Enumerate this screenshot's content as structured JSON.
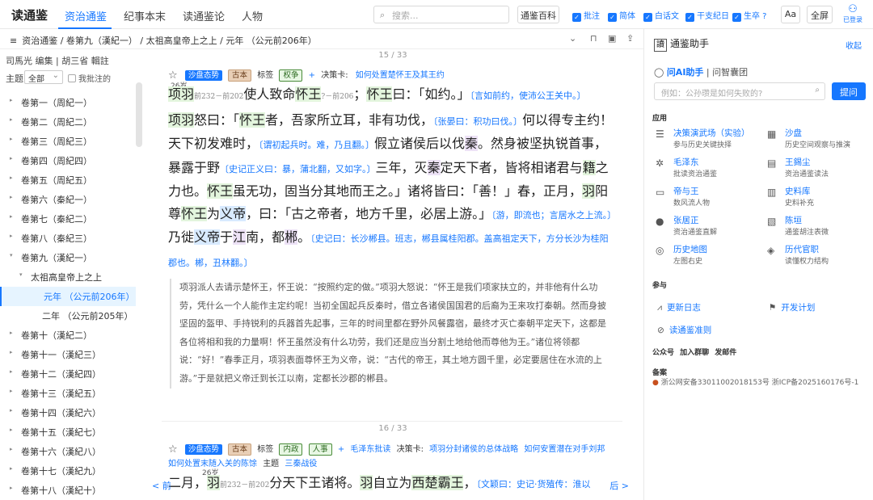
{
  "app": {
    "logo": "读通鉴"
  },
  "nav": {
    "tabs": [
      "资治通鉴",
      "纪事本末",
      "读通鉴论",
      "人物"
    ]
  },
  "search": {
    "placeholder": "搜索..."
  },
  "toolbar": {
    "encyclopedia": "通鉴百科",
    "toggles": [
      "批注",
      "简体",
      "白话文",
      "干支纪日",
      "生卒 ?"
    ],
    "font": "Aa",
    "fullscreen": "全屏",
    "login": "已登录"
  },
  "breadcrumb": {
    "text": "资治通鉴 / 卷第九（漢紀一） / 太祖高皇帝上之上 / 元年 （公元前206年）"
  },
  "sidebar": {
    "authors": "司馬光 编集 | 胡三省 輯註",
    "theme_label": "主题",
    "theme_value": "全部",
    "only_annotated": "我批注的",
    "volumes": [
      {
        "label": "卷第一（周紀一）",
        "level": 0,
        "arrow": "▸"
      },
      {
        "label": "卷第二（周紀二）",
        "level": 0,
        "arrow": "▸"
      },
      {
        "label": "卷第三（周紀三）",
        "level": 0,
        "arrow": "▸"
      },
      {
        "label": "卷第四（周紀四）",
        "level": 0,
        "arrow": "▸"
      },
      {
        "label": "卷第五（周紀五）",
        "level": 0,
        "arrow": "▸"
      },
      {
        "label": "卷第六（秦紀一）",
        "level": 0,
        "arrow": "▸"
      },
      {
        "label": "卷第七（秦紀二）",
        "level": 0,
        "arrow": "▸"
      },
      {
        "label": "卷第八（秦紀三）",
        "level": 0,
        "arrow": "▸"
      },
      {
        "label": "卷第九（漢紀一）",
        "level": 0,
        "arrow": "▾"
      },
      {
        "label": "太祖高皇帝上之上",
        "level": 1,
        "arrow": "▾"
      },
      {
        "label": "元年 （公元前206年）",
        "level": 2,
        "arrow": "",
        "selected": true
      },
      {
        "label": "二年 （公元前205年）",
        "level": 2,
        "arrow": ""
      },
      {
        "label": "卷第十（漢紀二）",
        "level": 0,
        "arrow": "▸"
      },
      {
        "label": "卷第十一（漢紀三）",
        "level": 0,
        "arrow": "▸"
      },
      {
        "label": "卷第十二（漢紀四）",
        "level": 0,
        "arrow": "▸"
      },
      {
        "label": "卷第十三（漢紀五）",
        "level": 0,
        "arrow": "▸"
      },
      {
        "label": "卷第十四（漢紀六）",
        "level": 0,
        "arrow": "▸"
      },
      {
        "label": "卷第十五（漢紀七）",
        "level": 0,
        "arrow": "▸"
      },
      {
        "label": "卷第十六（漢紀八）",
        "level": 0,
        "arrow": "▸"
      },
      {
        "label": "卷第十七（漢紀九）",
        "level": 0,
        "arrow": "▸"
      },
      {
        "label": "卷第十八（漢紀十）",
        "level": 0,
        "arrow": "▸"
      }
    ]
  },
  "content": {
    "page1": "15 / 33",
    "page2": "16 / 33",
    "p1": {
      "tags": [
        "沙盘态势",
        "古本"
      ],
      "tag_label": "标签",
      "label_tags": [
        "权争"
      ],
      "plus": "+",
      "card_label": "决策卡:",
      "cards": [
        "如何处置楚怀王及其王约"
      ],
      "age": "26岁"
    },
    "p2": {
      "tags": [
        "沙盘态势",
        "古本"
      ],
      "tag_label": "标签",
      "label_tags": [
        "内政",
        "人事"
      ],
      "plus": "+",
      "commentary": "毛泽东批读",
      "card_label": "决策卡:",
      "cards": [
        "项羽分封诸侯的总体战略",
        "如何安置潜在对手刘邦",
        "如何处置末随入关的陈馀"
      ],
      "theme_label": "主题",
      "theme": "三秦战役",
      "age": "26岁"
    },
    "translation": "项羽派人去请示楚怀王，怀王说：“按照约定的做。”项羽大怒说：“怀王是我们项家扶立的，并非他有什么功劳，凭什么一个人能作主定约呢！当初全国起兵反秦时，借立各诸侯国国君的后裔为王来攻打秦朝。然而身披坚固的盔甲、手持锐利的兵器首先起事，三年的时间里都在野外风餐露宿，最终才灭亡秦朝平定天下，这都是各位将相和我的力量啊！怀王虽然没有什么功劳，我们还是应当分割土地给他而尊他为王。”诸位将领都说：“好！”春季正月，项羽表面尊怀王为义帝，说：“古代的帝王，其土地方圆千里，必定要居住在水流的上游。”于是就把义帝迁到长江以南，定都长沙郡的郴县。",
    "prev": "< 前",
    "next": "后 >"
  },
  "right": {
    "title": "通鉴助手",
    "badge": "讀",
    "collapse": "收起",
    "ai_title": "问AI助手",
    "ai_sub": "| 问智囊团",
    "ai_placeholder": "例如：公孙瓒是如何失败的?",
    "ask": "提问",
    "apps_label": "应用",
    "apps": [
      {
        "name": "决策演武场（实验）",
        "desc": "参与历史关键抉择",
        "icon": "☰"
      },
      {
        "name": "沙盘",
        "desc": "历史空间观察与推演",
        "icon": "▦"
      },
      {
        "name": "毛泽东",
        "desc": "批读资治通鉴",
        "icon": "✲"
      },
      {
        "name": "王錫尘",
        "desc": "资治通鉴读法",
        "icon": "▤"
      },
      {
        "name": "帝与王",
        "desc": "数风流人物",
        "icon": "▭"
      },
      {
        "name": "史料库",
        "desc": "史料补充",
        "icon": "▥"
      },
      {
        "name": "张居正",
        "desc": "资治通鉴直解",
        "icon": "●"
      },
      {
        "name": "陈垣",
        "desc": "通鉴胡注表微",
        "icon": "▧"
      },
      {
        "name": "历史地图",
        "desc": "左图右史",
        "icon": "◎"
      },
      {
        "name": "历代官职",
        "desc": "读懂权力结构",
        "icon": "◈"
      }
    ],
    "join_label": "参与",
    "changelog": "更新日志",
    "devplan": "开发计划",
    "guidelines": "读通鉴准则",
    "social": "公众号 加入群聊 发邮件",
    "beian_label": "备案",
    "beian": "浙公网安备33011002018153号 浙ICP备2025160176号-1"
  }
}
